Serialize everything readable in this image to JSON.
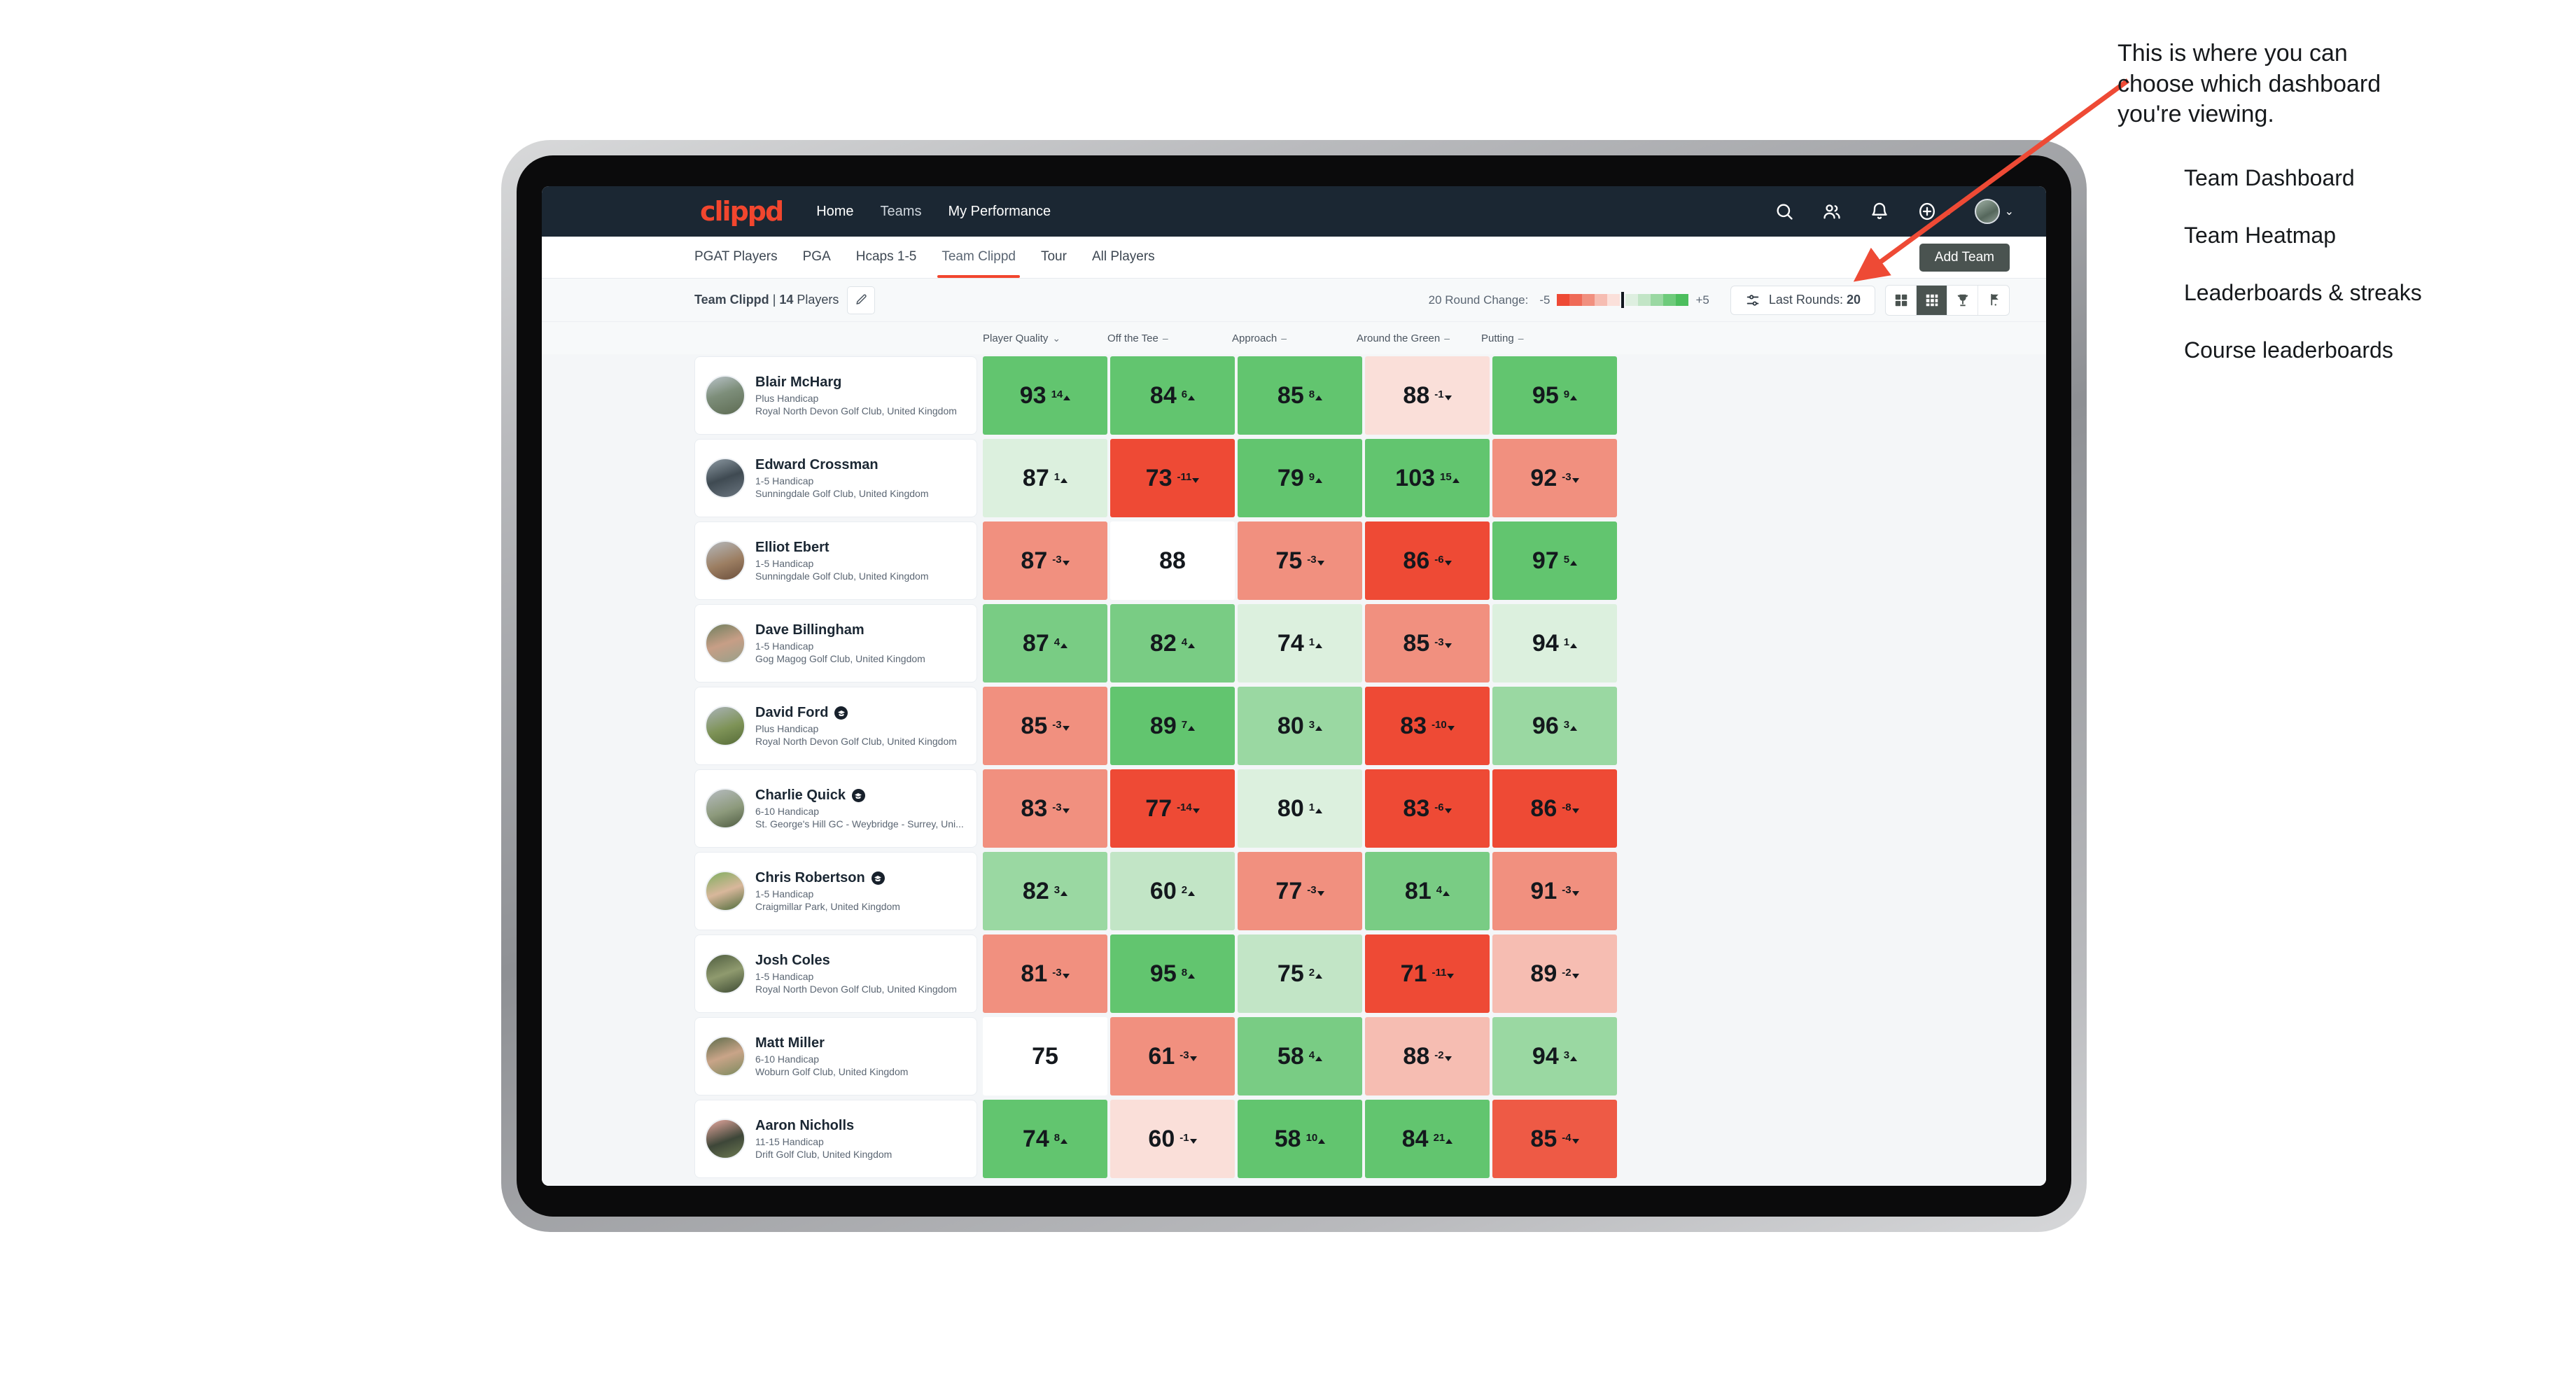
{
  "navbar": {
    "brand": "clippd",
    "links": [
      {
        "label": "Home",
        "active": true
      },
      {
        "label": "Teams",
        "active": false
      },
      {
        "label": "My Performance",
        "active": true
      }
    ],
    "icons": [
      "search-icon",
      "people-icon",
      "bell-icon",
      "plus-circle-icon"
    ],
    "accent_color": "#f2462e",
    "bar_color": "#1b2733"
  },
  "tabs": [
    {
      "label": "PGAT Players",
      "selected": false
    },
    {
      "label": "PGA",
      "selected": false
    },
    {
      "label": "Hcaps 1-5",
      "selected": false
    },
    {
      "label": "Team Clippd",
      "selected": true
    },
    {
      "label": "Tour",
      "selected": false
    },
    {
      "label": "All Players",
      "selected": false
    }
  ],
  "add_team_button": "Add Team",
  "filterbar": {
    "team_name": "Team Clippd",
    "team_separator": " | ",
    "team_count": "14",
    "team_count_suffix": " Players",
    "edit_icon": "pencil-icon",
    "legend_label": "20 Round Change:",
    "legend_min": "-5",
    "legend_max": "+5",
    "legend_colors": [
      "#ee4a35",
      "#ef6a57",
      "#f1907f",
      "#f6bdb2",
      "#fbe0da",
      "#deefe0",
      "#c2e5c6",
      "#9ad8a2",
      "#6ecb7b",
      "#4cbe5d"
    ],
    "last_rounds_label": "Last Rounds:",
    "last_rounds_value": "20",
    "view_toggle": [
      {
        "name": "grid-large-icon",
        "active": false
      },
      {
        "name": "grid-small-icon",
        "active": true
      },
      {
        "name": "trophy-icon",
        "active": false
      },
      {
        "name": "flag-icon",
        "active": false
      }
    ]
  },
  "chart_data": {
    "type": "heatmap",
    "title": "Team Clippd | 14 Players",
    "columns": [
      {
        "label": "Player Quality",
        "marker": "chevron-down"
      },
      {
        "label": "Off the Tee",
        "marker": "dash"
      },
      {
        "label": "Approach",
        "marker": "dash"
      },
      {
        "label": "Around the Green",
        "marker": "dash"
      },
      {
        "label": "Putting",
        "marker": "dash"
      }
    ],
    "legend": {
      "min": -5,
      "max": 5,
      "label": "20 Round Change"
    },
    "rows": [
      {
        "name": "Blair McHarg",
        "badge": false,
        "handicap": "Plus Handicap",
        "club": "Royal North Devon Golf Club, United Kingdom",
        "avatar": "linear-gradient(160deg,#b9c3c9 0%,#7d8e7a 45%,#5d6b52 100%)",
        "cells": [
          {
            "value": "93",
            "delta": "14",
            "dir": "up",
            "bg": "#62c56f"
          },
          {
            "value": "84",
            "delta": "6",
            "dir": "up",
            "bg": "#62c56f"
          },
          {
            "value": "85",
            "delta": "8",
            "dir": "up",
            "bg": "#62c56f"
          },
          {
            "value": "88",
            "delta": "-1",
            "dir": "down",
            "bg": "#fadfd9"
          },
          {
            "value": "95",
            "delta": "9",
            "dir": "up",
            "bg": "#62c56f"
          }
        ]
      },
      {
        "name": "Edward Crossman",
        "badge": false,
        "handicap": "1-5 Handicap",
        "club": "Sunningdale Golf Club, United Kingdom",
        "avatar": "linear-gradient(160deg,#8d9aa3 0%,#3f4a52 50%,#6b7680 100%)",
        "cells": [
          {
            "value": "87",
            "delta": "1",
            "dir": "up",
            "bg": "#dcf0de"
          },
          {
            "value": "73",
            "delta": "-11",
            "dir": "down",
            "bg": "#ee4a35"
          },
          {
            "value": "79",
            "delta": "9",
            "dir": "up",
            "bg": "#62c56f"
          },
          {
            "value": "103",
            "delta": "15",
            "dir": "up",
            "bg": "#62c56f"
          },
          {
            "value": "92",
            "delta": "-3",
            "dir": "down",
            "bg": "#f1907f"
          }
        ]
      },
      {
        "name": "Elliot Ebert",
        "badge": false,
        "handicap": "1-5 Handicap",
        "club": "Sunningdale Golf Club, United Kingdom",
        "avatar": "linear-gradient(160deg,#b4b8bc 0%,#9c7e62 55%,#6b4f3c 100%)",
        "cells": [
          {
            "value": "87",
            "delta": "-3",
            "dir": "down",
            "bg": "#f1907f"
          },
          {
            "value": "88",
            "delta": "",
            "dir": "",
            "bg": "#ffffff"
          },
          {
            "value": "75",
            "delta": "-3",
            "dir": "down",
            "bg": "#f1907f"
          },
          {
            "value": "86",
            "delta": "-6",
            "dir": "down",
            "bg": "#ee4a35"
          },
          {
            "value": "97",
            "delta": "5",
            "dir": "up",
            "bg": "#62c56f"
          }
        ]
      },
      {
        "name": "Dave Billingham",
        "badge": false,
        "handicap": "1-5 Handicap",
        "club": "Gog Magog Golf Club, United Kingdom",
        "avatar": "linear-gradient(160deg,#6f7f5e 0%,#c79e86 50%,#97a089 100%)",
        "cells": [
          {
            "value": "87",
            "delta": "4",
            "dir": "up",
            "bg": "#79cc84"
          },
          {
            "value": "82",
            "delta": "4",
            "dir": "up",
            "bg": "#79cc84"
          },
          {
            "value": "74",
            "delta": "1",
            "dir": "up",
            "bg": "#dcf0de"
          },
          {
            "value": "85",
            "delta": "-3",
            "dir": "down",
            "bg": "#f1907f"
          },
          {
            "value": "94",
            "delta": "1",
            "dir": "up",
            "bg": "#dcf0de"
          }
        ]
      },
      {
        "name": "David Ford",
        "badge": true,
        "handicap": "Plus Handicap",
        "club": "Royal North Devon Golf Club, United Kingdom",
        "avatar": "linear-gradient(160deg,#aab3b8 0%,#7e9357 55%,#566b38 100%)",
        "cells": [
          {
            "value": "85",
            "delta": "-3",
            "dir": "down",
            "bg": "#f1907f"
          },
          {
            "value": "89",
            "delta": "7",
            "dir": "up",
            "bg": "#62c56f"
          },
          {
            "value": "80",
            "delta": "3",
            "dir": "up",
            "bg": "#9ad8a2"
          },
          {
            "value": "83",
            "delta": "-10",
            "dir": "down",
            "bg": "#ee4a35"
          },
          {
            "value": "96",
            "delta": "3",
            "dir": "up",
            "bg": "#9ad8a2"
          }
        ]
      },
      {
        "name": "Charlie Quick",
        "badge": true,
        "handicap": "6-10 Handicap",
        "club": "St. George's Hill GC - Weybridge - Surrey, Uni...",
        "avatar": "linear-gradient(160deg,#b6bcc0 0%,#8d9a7c 55%,#4f5c42 100%)",
        "cells": [
          {
            "value": "83",
            "delta": "-3",
            "dir": "down",
            "bg": "#f1907f"
          },
          {
            "value": "77",
            "delta": "-14",
            "dir": "down",
            "bg": "#ee4a35"
          },
          {
            "value": "80",
            "delta": "1",
            "dir": "up",
            "bg": "#dcf0de"
          },
          {
            "value": "83",
            "delta": "-6",
            "dir": "down",
            "bg": "#ee4a35"
          },
          {
            "value": "86",
            "delta": "-8",
            "dir": "down",
            "bg": "#ee4a35"
          }
        ]
      },
      {
        "name": "Chris Robertson",
        "badge": true,
        "handicap": "1-5 Handicap",
        "club": "Craigmillar Park, United Kingdom",
        "avatar": "linear-gradient(160deg,#7fae5f 0%,#d8b79b 50%,#4d6b3a 100%)",
        "cells": [
          {
            "value": "82",
            "delta": "3",
            "dir": "up",
            "bg": "#9ad8a2"
          },
          {
            "value": "60",
            "delta": "2",
            "dir": "up",
            "bg": "#c2e5c6"
          },
          {
            "value": "77",
            "delta": "-3",
            "dir": "down",
            "bg": "#f1907f"
          },
          {
            "value": "81",
            "delta": "4",
            "dir": "up",
            "bg": "#79cc84"
          },
          {
            "value": "91",
            "delta": "-3",
            "dir": "down",
            "bg": "#f1907f"
          }
        ]
      },
      {
        "name": "Josh Coles",
        "badge": false,
        "handicap": "1-5 Handicap",
        "club": "Royal North Devon Golf Club, United Kingdom",
        "avatar": "linear-gradient(160deg,#4e5c3f 0%,#8f9a6e 50%,#3d4a33 100%)",
        "cells": [
          {
            "value": "81",
            "delta": "-3",
            "dir": "down",
            "bg": "#f1907f"
          },
          {
            "value": "95",
            "delta": "8",
            "dir": "up",
            "bg": "#62c56f"
          },
          {
            "value": "75",
            "delta": "2",
            "dir": "up",
            "bg": "#c2e5c6"
          },
          {
            "value": "71",
            "delta": "-11",
            "dir": "down",
            "bg": "#ee4a35"
          },
          {
            "value": "89",
            "delta": "-2",
            "dir": "down",
            "bg": "#f6bdb2"
          }
        ]
      },
      {
        "name": "Matt Miller",
        "badge": false,
        "handicap": "6-10 Handicap",
        "club": "Woburn Golf Club, United Kingdom",
        "avatar": "linear-gradient(160deg,#5c6b4a 0%,#c9a488 50%,#7b8a5e 100%)",
        "cells": [
          {
            "value": "75",
            "delta": "",
            "dir": "",
            "bg": "#ffffff"
          },
          {
            "value": "61",
            "delta": "-3",
            "dir": "down",
            "bg": "#f1907f"
          },
          {
            "value": "58",
            "delta": "4",
            "dir": "up",
            "bg": "#79cc84"
          },
          {
            "value": "88",
            "delta": "-2",
            "dir": "down",
            "bg": "#f6bdb2"
          },
          {
            "value": "94",
            "delta": "3",
            "dir": "up",
            "bg": "#9ad8a2"
          }
        ]
      },
      {
        "name": "Aaron Nicholls",
        "badge": false,
        "handicap": "11-15 Handicap",
        "club": "Drift Golf Club, United Kingdom",
        "avatar": "linear-gradient(160deg,#e8a9a0 0%,#3d4638 55%,#6d7a52 100%)",
        "cells": [
          {
            "value": "74",
            "delta": "8",
            "dir": "up",
            "bg": "#62c56f"
          },
          {
            "value": "60",
            "delta": "-1",
            "dir": "down",
            "bg": "#fadfd9"
          },
          {
            "value": "58",
            "delta": "10",
            "dir": "up",
            "bg": "#62c56f"
          },
          {
            "value": "84",
            "delta": "21",
            "dir": "up",
            "bg": "#62c56f"
          },
          {
            "value": "85",
            "delta": "-4",
            "dir": "down",
            "bg": "#ee5a45"
          }
        ]
      }
    ]
  },
  "annotation": {
    "callout": "This is where you can\nchoose which dashboard\nyou're viewing.",
    "arrow_color": "#ee4a35",
    "items": [
      "Team Dashboard",
      "Team Heatmap",
      "Leaderboards & streaks",
      "Course leaderboards"
    ]
  }
}
